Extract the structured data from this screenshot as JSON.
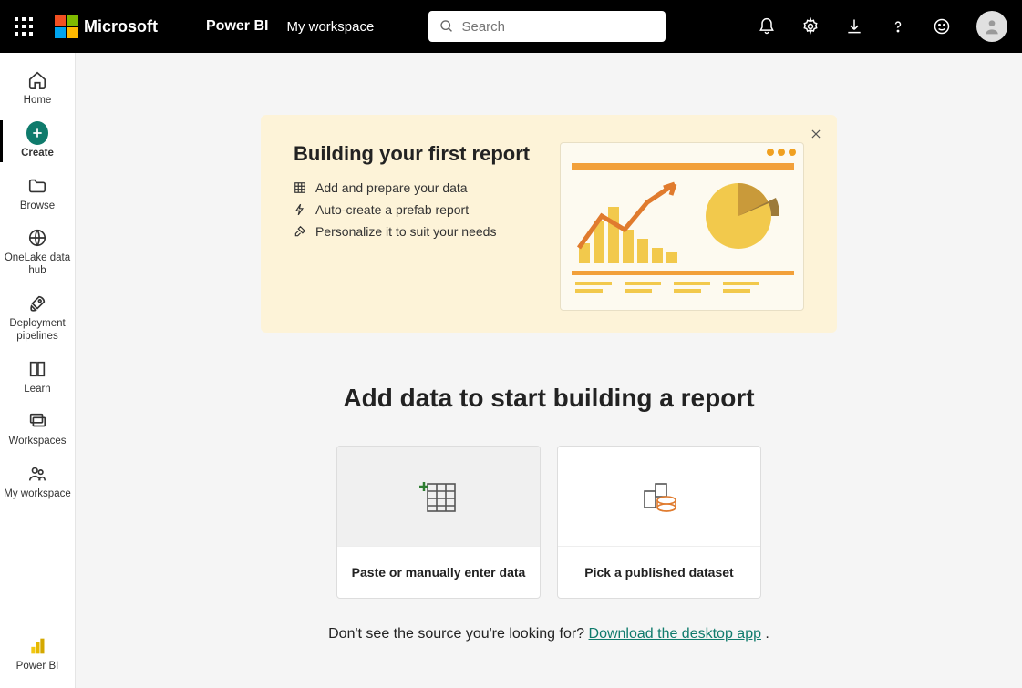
{
  "header": {
    "brand": "Microsoft",
    "app": "Power BI",
    "breadcrumb": "My workspace",
    "search_placeholder": "Search"
  },
  "sidebar": {
    "items": [
      {
        "label": "Home"
      },
      {
        "label": "Create"
      },
      {
        "label": "Browse"
      },
      {
        "label": "OneLake data hub"
      },
      {
        "label": "Deployment pipelines"
      },
      {
        "label": "Learn"
      },
      {
        "label": "Workspaces"
      },
      {
        "label": "My workspace"
      }
    ],
    "bottom": {
      "label": "Power BI"
    }
  },
  "banner": {
    "title": "Building your first report",
    "steps": [
      "Add and prepare your data",
      "Auto-create a prefab report",
      "Personalize it to suit your needs"
    ]
  },
  "main": {
    "heading": "Add data to start building a report",
    "cards": [
      {
        "label": "Paste or manually enter data"
      },
      {
        "label": "Pick a published dataset"
      }
    ],
    "footer_prefix": "Don't see the source you're looking for?  ",
    "footer_link": "Download the desktop app",
    "footer_suffix": " ."
  }
}
